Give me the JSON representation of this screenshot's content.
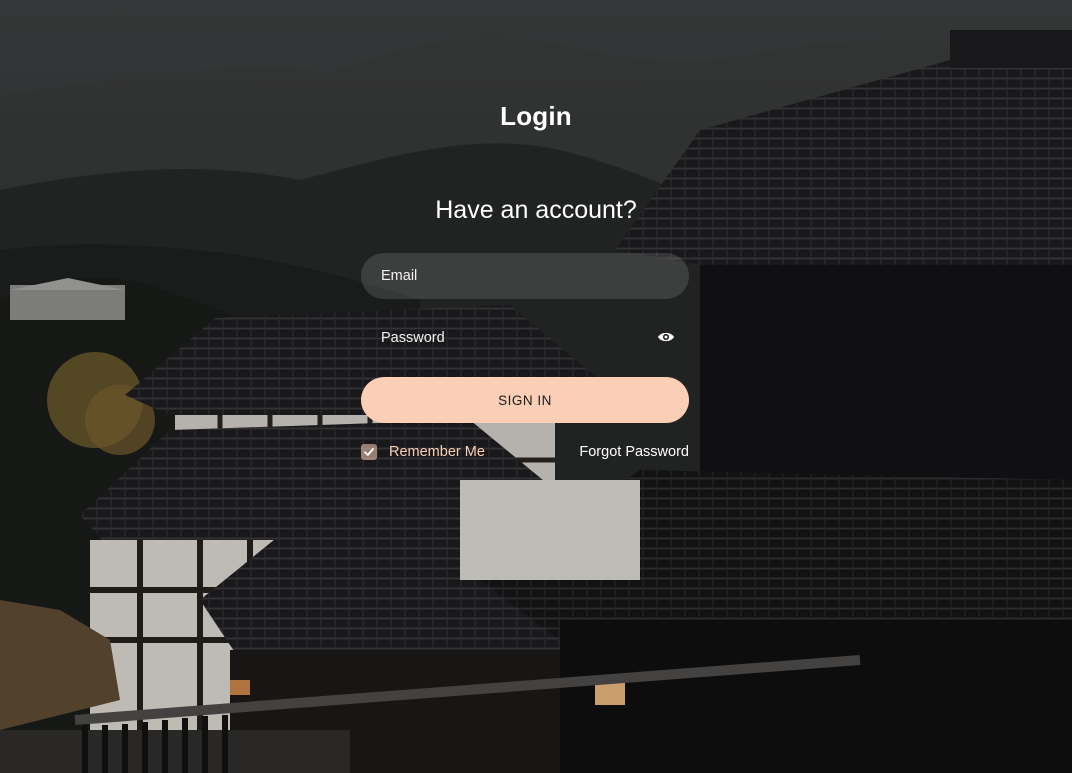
{
  "page": {
    "title": "Login",
    "subtitle": "Have an account?"
  },
  "form": {
    "email_placeholder": "Email",
    "email_value": "",
    "password_placeholder": "Password",
    "password_value": "",
    "signin_label": "SIGN IN",
    "remember_label": "Remember Me",
    "remember_checked": true,
    "forgot_label": "Forgot Password"
  },
  "icons": {
    "password_toggle": "eye-icon",
    "remember_check": "check-icon"
  },
  "colors": {
    "accent": "#fbcfb5",
    "text": "#ffffff",
    "field_bg": "rgba(255,255,255,0.13)"
  }
}
